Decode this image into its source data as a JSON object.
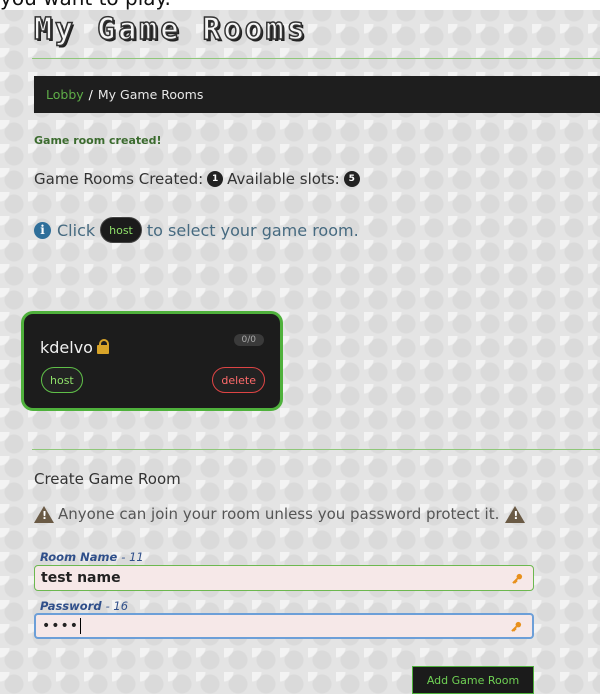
{
  "top_fragment": "you want to play.",
  "page_title": "My Game Rooms",
  "breadcrumb": {
    "lobby": "Lobby",
    "separator": "/",
    "current": "My Game Rooms"
  },
  "flash_message": "Game room created!",
  "stats": {
    "created_label": "Game Rooms Created:",
    "created_count": "1",
    "slots_label": "Available slots:",
    "slots_count": "5"
  },
  "hint": {
    "before": "Click",
    "button": "host",
    "after": "to select your game room."
  },
  "rooms": [
    {
      "name": "kdelvo",
      "locked": true,
      "slots": "0/0",
      "host_label": "host",
      "delete_label": "delete"
    }
  ],
  "create_form": {
    "title": "Create Game Room",
    "warning": "Anyone can join your room unless you password protect it.",
    "room_name_label": "Room Name",
    "room_name_remaining": "- 11",
    "room_name_value": "test name",
    "password_label": "Password",
    "password_remaining": "- 16",
    "password_value": "••••",
    "submit_label": "Add Game Room"
  },
  "colors": {
    "accent_green": "#4fb13c",
    "danger_red": "#d44444",
    "card_bg": "#1c1c1c"
  }
}
